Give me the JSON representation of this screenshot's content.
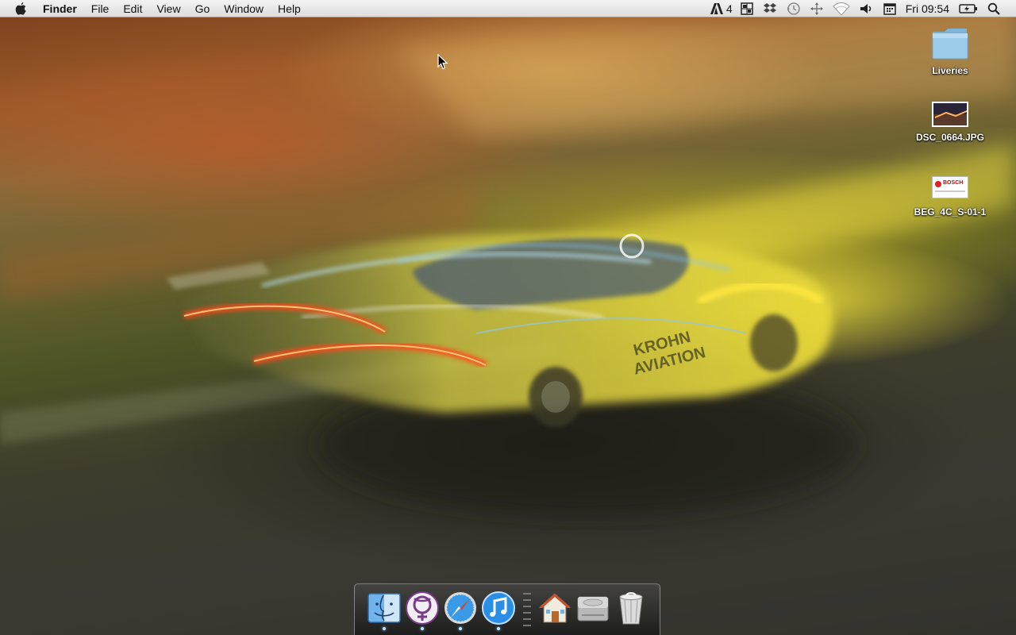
{
  "menubar": {
    "app_name": "Finder",
    "menus": [
      "File",
      "Edit",
      "View",
      "Go",
      "Window",
      "Help"
    ],
    "status": {
      "adobe_badge": "4",
      "clock": "Fri 09:54"
    }
  },
  "desktop": {
    "icons": [
      {
        "label": "Liveries",
        "icon": "folder-icon"
      },
      {
        "label": "DSC_0664.JPG",
        "icon": "image-thumbnail-icon"
      },
      {
        "label": "BEG_4C_S-01-1",
        "icon": "document-thumbnail-icon"
      }
    ],
    "wallpaper": {
      "car_text": [
        "KROHN",
        "AVIATION"
      ],
      "thumbnail_brand": "BOSCH"
    }
  },
  "dock": {
    "items": [
      "finder-icon",
      "adium-icon",
      "safari-icon",
      "itunes-icon",
      "home-folder-icon",
      "hard-drive-icon",
      "trash-icon"
    ],
    "running": [
      "finder-icon",
      "adium-icon",
      "safari-icon",
      "itunes-icon"
    ]
  },
  "colors": {
    "menubar_bg": "#e8e8e8",
    "folder_blue": "#8fc3e6",
    "car_yellow": "#e3d23a",
    "taillight_red": "#ff4a1a",
    "dock_indicator": "#bfe4ff"
  }
}
